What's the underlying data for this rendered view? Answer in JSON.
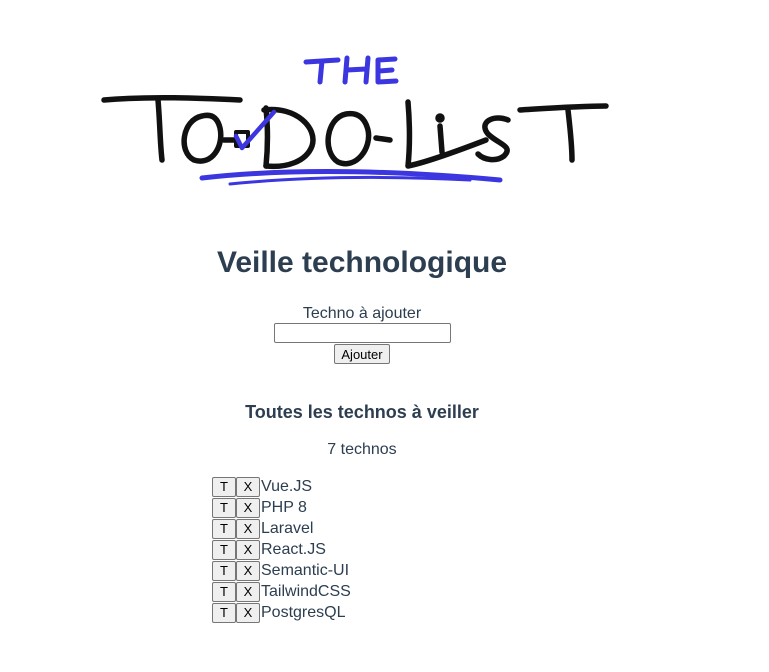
{
  "logo": {
    "top_word": "THE",
    "main_word": "TO-DO LIST"
  },
  "title": "Veille technologique",
  "form": {
    "label": "Techno à ajouter",
    "input_value": "",
    "input_placeholder": "",
    "submit_label": "Ajouter"
  },
  "list_title": "Toutes les technos à veiller",
  "count_text": "7 technos",
  "item_buttons": {
    "toggle_label": "T",
    "delete_label": "X"
  },
  "items": [
    {
      "name": "Vue.JS"
    },
    {
      "name": "PHP 8"
    },
    {
      "name": "Laravel"
    },
    {
      "name": "React.JS"
    },
    {
      "name": "Semantic-UI"
    },
    {
      "name": "TailwindCSS"
    },
    {
      "name": "PostgresQL"
    }
  ],
  "colors": {
    "text": "#2c3e50",
    "logo_ink": "#111111",
    "logo_accent": "#3b36e0"
  }
}
